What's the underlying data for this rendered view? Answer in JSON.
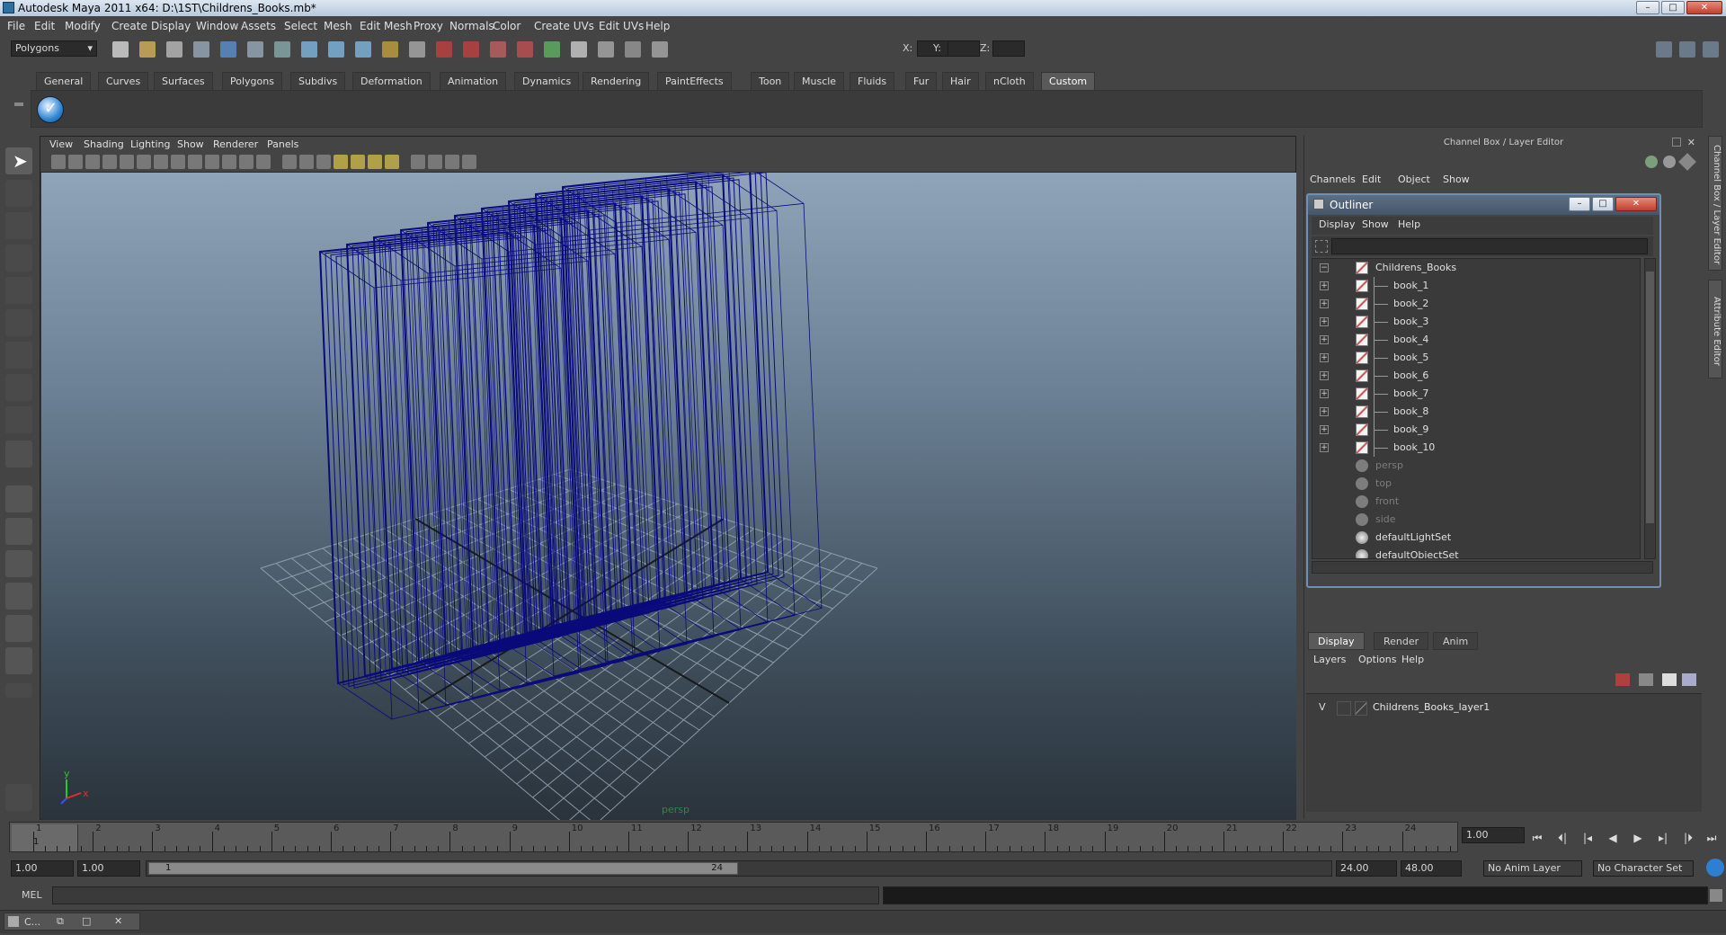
{
  "window": {
    "title": "Autodesk Maya 2011 x64: D:\\1ST\\Childrens_Books.mb*",
    "minimize": "–",
    "maximize": "□",
    "close": "✕"
  },
  "menubar": [
    "File",
    "Edit",
    "Modify",
    "Create",
    "Display",
    "Window",
    "Assets",
    "Select",
    "Mesh",
    "Edit Mesh",
    "Proxy",
    "Normals",
    "Color",
    "Create UVs",
    "Edit UVs",
    "Help"
  ],
  "statusline": {
    "mode": "Polygons",
    "x_label": "X:",
    "y_label": "Y:",
    "z_label": "Z:"
  },
  "shelf_tabs": [
    "General",
    "Curves",
    "Surfaces",
    "Polygons",
    "Subdivs",
    "Deformation",
    "Animation",
    "Dynamics",
    "Rendering",
    "PaintEffects",
    "Toon",
    "Muscle",
    "Fluids",
    "Fur",
    "Hair",
    "nCloth",
    "Custom"
  ],
  "shelf_active": "Custom",
  "viewport": {
    "menu": [
      "View",
      "Shading",
      "Lighting",
      "Show",
      "Renderer",
      "Panels"
    ],
    "camera_label": "persp",
    "axis_y": "y",
    "axis_x": "x"
  },
  "channel_box": {
    "title": "Channel Box / Layer Editor",
    "menu": [
      "Channels",
      "Edit",
      "Object",
      "Show"
    ]
  },
  "outliner": {
    "title": "Outliner",
    "menu": [
      "Display",
      "Show",
      "Help"
    ],
    "items": [
      {
        "label": "Childrens_Books",
        "expand": "−",
        "kind": "group",
        "indent": 0,
        "dim": false
      },
      {
        "label": "book_1",
        "expand": "+",
        "kind": "mesh",
        "indent": 1,
        "dim": false
      },
      {
        "label": "book_2",
        "expand": "+",
        "kind": "mesh",
        "indent": 1,
        "dim": false
      },
      {
        "label": "book_3",
        "expand": "+",
        "kind": "mesh",
        "indent": 1,
        "dim": false
      },
      {
        "label": "book_4",
        "expand": "+",
        "kind": "mesh",
        "indent": 1,
        "dim": false
      },
      {
        "label": "book_5",
        "expand": "+",
        "kind": "mesh",
        "indent": 1,
        "dim": false
      },
      {
        "label": "book_6",
        "expand": "+",
        "kind": "mesh",
        "indent": 1,
        "dim": false
      },
      {
        "label": "book_7",
        "expand": "+",
        "kind": "mesh",
        "indent": 1,
        "dim": false
      },
      {
        "label": "book_8",
        "expand": "+",
        "kind": "mesh",
        "indent": 1,
        "dim": false
      },
      {
        "label": "book_9",
        "expand": "+",
        "kind": "mesh",
        "indent": 1,
        "dim": false
      },
      {
        "label": "book_10",
        "expand": "+",
        "kind": "mesh",
        "indent": 1,
        "dim": false
      },
      {
        "label": "persp",
        "expand": "",
        "kind": "camera",
        "indent": 0,
        "dim": true
      },
      {
        "label": "top",
        "expand": "",
        "kind": "camera",
        "indent": 0,
        "dim": true
      },
      {
        "label": "front",
        "expand": "",
        "kind": "camera",
        "indent": 0,
        "dim": true
      },
      {
        "label": "side",
        "expand": "",
        "kind": "camera",
        "indent": 0,
        "dim": true
      },
      {
        "label": "defaultLightSet",
        "expand": "",
        "kind": "set",
        "indent": 0,
        "dim": false
      },
      {
        "label": "defaultObjectSet",
        "expand": "",
        "kind": "set",
        "indent": 0,
        "dim": false
      }
    ]
  },
  "layer_editor": {
    "tabs": [
      "Display",
      "Render",
      "Anim"
    ],
    "active_tab": "Display",
    "menu": [
      "Layers",
      "Options",
      "Help"
    ],
    "layers": [
      {
        "visible": "V",
        "name": "Childrens_Books_layer1"
      }
    ]
  },
  "side_tabs": [
    "Channel Box / Layer Editor",
    "Attribute Editor"
  ],
  "timeslider": {
    "ticks": [
      "1",
      "2",
      "3",
      "4",
      "5",
      "6",
      "7",
      "8",
      "9",
      "10",
      "11",
      "12",
      "13",
      "14",
      "15",
      "16",
      "17",
      "18",
      "19",
      "20",
      "21",
      "22",
      "23",
      "24"
    ],
    "current_frame_label": "1",
    "current_time": "1.00"
  },
  "range": {
    "start_time": "1.00",
    "range_start": "1.00",
    "range_start_label": "1",
    "range_end_label": "24",
    "range_end": "24.00",
    "end_time": "48.00",
    "anim_layer": "No Anim Layer",
    "character_set": "No Character Set"
  },
  "command_line": {
    "mode": "MEL"
  },
  "taskbar": {
    "item": "C..."
  }
}
